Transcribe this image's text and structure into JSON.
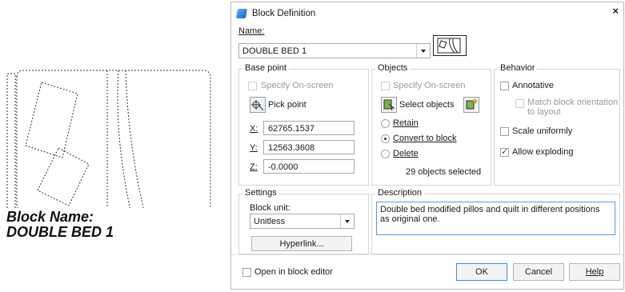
{
  "drawing": {
    "caption_line1": "Block Name:",
    "caption_line2": "DOUBLE BED 1"
  },
  "dialog": {
    "title": "Block Definition",
    "close": "×",
    "name_label": "Name:",
    "name_value": "DOUBLE BED 1",
    "base_point": {
      "title": "Base point",
      "specify_onscreen": "Specify On-screen",
      "pick_point": "Pick point",
      "x_label": "X:",
      "x_value": "62765.1537",
      "y_label": "Y:",
      "y_value": "12563.3608",
      "z_label": "Z:",
      "z_value": "-0.0000"
    },
    "objects": {
      "title": "Objects",
      "specify_onscreen": "Specify On-screen",
      "select_objects": "Select objects",
      "retain": "Retain",
      "convert": "Convert to block",
      "delete": "Delete",
      "count_text": "29 objects selected",
      "selected_option": "Convert to block"
    },
    "behavior": {
      "title": "Behavior",
      "annotative": "Annotative",
      "match_line1": "Match block orientation",
      "match_line2": "to layout",
      "scale_uniformly": "Scale uniformly",
      "allow_exploding": "Allow exploding",
      "allow_exploding_checked": true
    },
    "settings": {
      "title": "Settings",
      "block_unit_label": "Block unit:",
      "block_unit_value": "Unitless",
      "hyperlink": "Hyperlink..."
    },
    "description": {
      "title": "Description",
      "text": "Double bed modified pillos and quilt in different positions as original one."
    },
    "footer": {
      "open_in_editor": "Open in block editor",
      "ok": "OK",
      "cancel": "Cancel",
      "help": "Help"
    }
  },
  "colors": {
    "accent": "#3c8fd6",
    "disabled_text": "#9a9a9a"
  }
}
